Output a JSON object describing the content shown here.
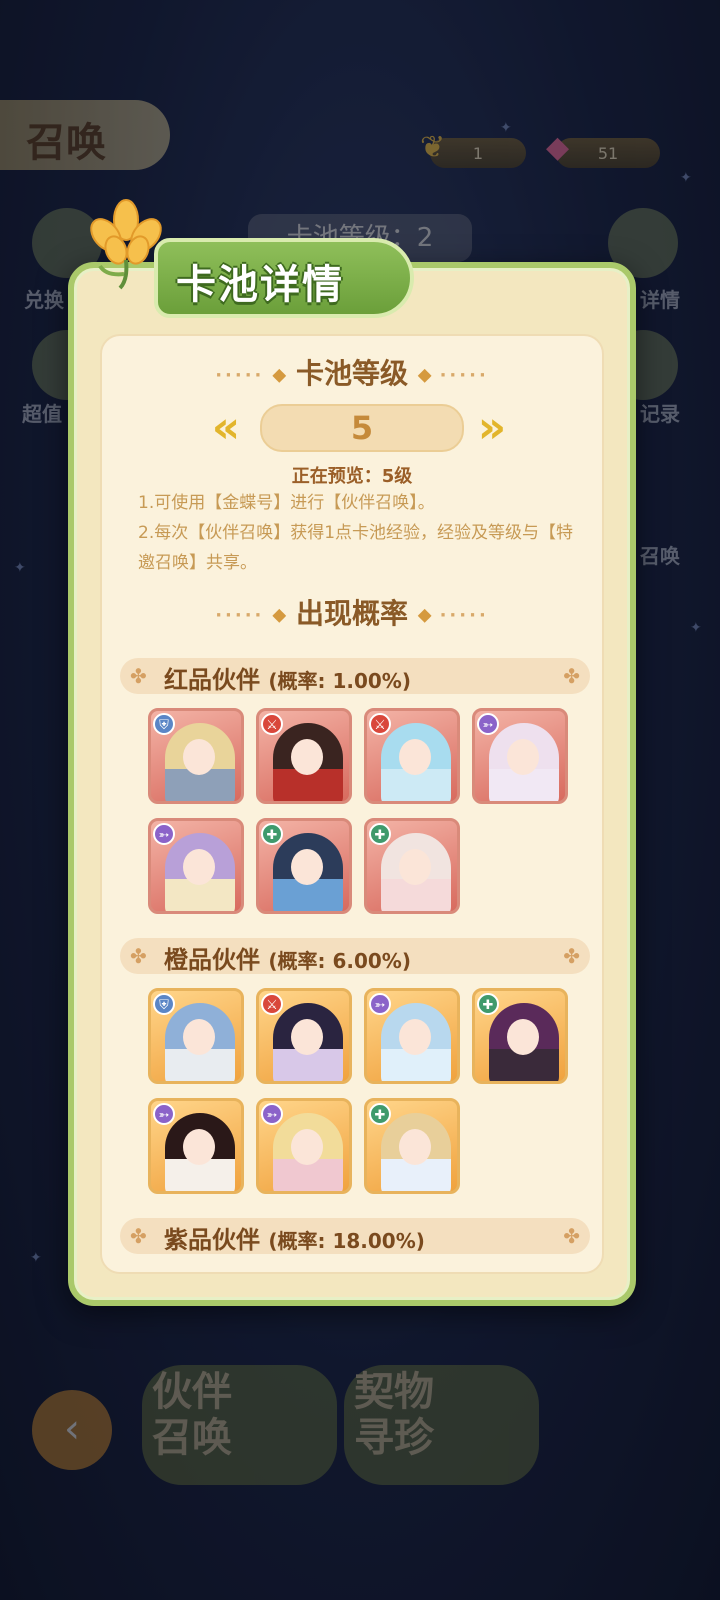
{
  "background": {
    "title": "召唤",
    "currency": [
      {
        "icon": "gold-shell-icon",
        "value": "1"
      },
      {
        "icon": "pink-gem-icon",
        "value": "51"
      }
    ],
    "pool_level_chip": "卡池等级：2",
    "left_buttons": [
      "兑换",
      "超值"
    ],
    "right_buttons": [
      "详情",
      "记录",
      "召唤"
    ],
    "bottom_buttons": [
      "伙伴召唤",
      "契物寻珍"
    ]
  },
  "modal": {
    "title": "卡池详情",
    "level_heading": "卡池等级",
    "level_value": "5",
    "previewing": "正在预览：5级",
    "rules": [
      "1.可使用【金蝶号】进行【伙伴召唤】。",
      "2.每次【伙伴召唤】获得1点卡池经验，经验及等级与【特邀召唤】共享。"
    ],
    "rate_heading": "出现概率",
    "tiers": [
      {
        "name": "红品伙伴",
        "rate": "(概率: 1.00%)",
        "characters": [
          {
            "cls": "shield-class-icon",
            "hair": "#e9d49a",
            "outfit": "#8ea0b8"
          },
          {
            "cls": "sword-class-icon",
            "hair": "#3a2420",
            "outfit": "#b8302a"
          },
          {
            "cls": "sword-class-icon",
            "hair": "#a8dcef",
            "outfit": "#cdeaf5"
          },
          {
            "cls": "bow-class-icon",
            "hair": "#eee0ee",
            "outfit": "#f1e8f4"
          },
          {
            "cls": "bow-class-icon",
            "hair": "#b8a0d8",
            "outfit": "#f3e7c4"
          },
          {
            "cls": "heal-class-icon",
            "hair": "#2c3c5a",
            "outfit": "#6aa0d4"
          },
          {
            "cls": "heal-class-icon",
            "hair": "#f1e4e0",
            "outfit": "#f5dada"
          }
        ]
      },
      {
        "name": "橙品伙伴",
        "rate": "(概率: 6.00%)",
        "characters": [
          {
            "cls": "shield-class-icon",
            "hair": "#8fb0d8",
            "outfit": "#e8ecf0"
          },
          {
            "cls": "sword-class-icon",
            "hair": "#2a2440",
            "outfit": "#d8c8e8"
          },
          {
            "cls": "bow-class-icon",
            "hair": "#b8d8ee",
            "outfit": "#e0f0fa"
          },
          {
            "cls": "heal-class-icon",
            "hair": "#5a2a5a",
            "outfit": "#3a2a3a"
          },
          {
            "cls": "bow-class-icon",
            "hair": "#2a1818",
            "outfit": "#f5f0ea"
          },
          {
            "cls": "bow-class-icon",
            "hair": "#f2dc9a",
            "outfit": "#f0c8d0"
          },
          {
            "cls": "heal-class-icon",
            "hair": "#e8cf9a",
            "outfit": "#e8f0fa"
          }
        ]
      },
      {
        "name": "紫品伙伴",
        "rate": "(概率: 18.00%)",
        "characters": []
      }
    ],
    "class_colors": {
      "shield-class-icon": "#5b86c6",
      "sword-class-icon": "#d9473b",
      "bow-class-icon": "#8b63c9",
      "heal-class-icon": "#3f9a6c"
    }
  }
}
